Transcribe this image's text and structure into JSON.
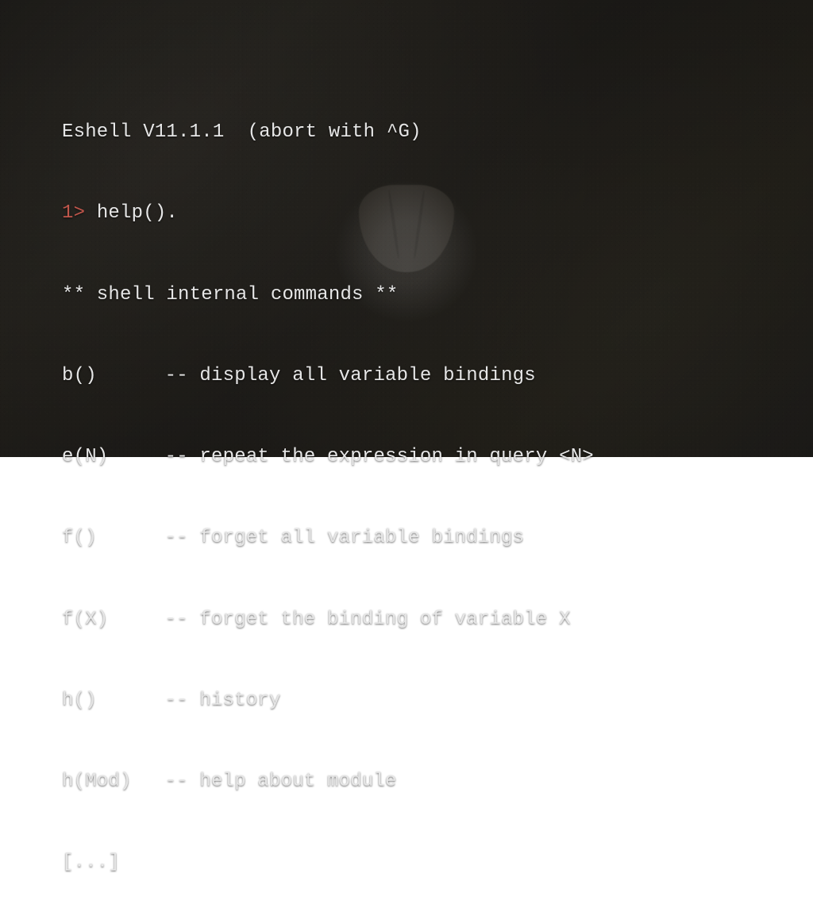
{
  "header": "Eshell V11.1.1  (abort with ^G)",
  "prompt": {
    "number": "1>",
    "command": " help()."
  },
  "section_title": "** shell internal commands **",
  "commands": [
    {
      "name": "b()",
      "sep": "-- ",
      "desc": "display all variable bindings"
    },
    {
      "name": "e(N)",
      "sep": "-- ",
      "desc": "repeat the expression in query <N>"
    },
    {
      "name": "f()",
      "sep": "-- ",
      "desc": "forget all variable bindings"
    },
    {
      "name": "f(X)",
      "sep": "-- ",
      "desc": "forget the binding of variable X"
    },
    {
      "name": "h()",
      "sep": "-- ",
      "desc": "history"
    },
    {
      "name": "h(Mod)",
      "sep": "-- ",
      "desc": "help about module"
    }
  ],
  "ellipsis": "[...]"
}
